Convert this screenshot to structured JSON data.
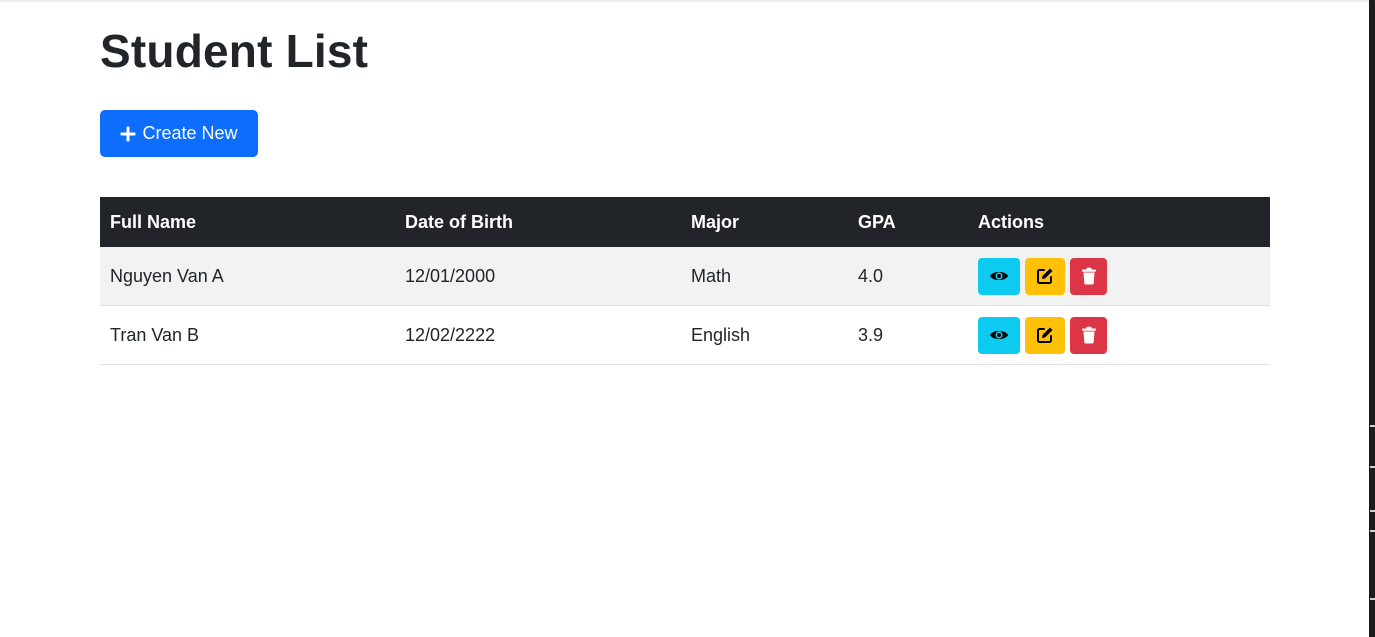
{
  "page": {
    "title": "Student List"
  },
  "toolbar": {
    "create_label": "Create New",
    "create_icon": "plus-icon",
    "create_color": "#0d6efd"
  },
  "table": {
    "header_bg": "#212529",
    "columns": [
      "Full Name",
      "Date of Birth",
      "Major",
      "GPA",
      "Actions"
    ],
    "rows": [
      {
        "full_name": "Nguyen Van A",
        "dob": "12/01/2000",
        "major": "Math",
        "gpa": "4.0"
      },
      {
        "full_name": "Tran Van B",
        "dob": "12/02/2222",
        "major": "English",
        "gpa": "3.9"
      }
    ],
    "actions": [
      {
        "name": "view",
        "icon": "eye-icon",
        "color": "#0dcaf0"
      },
      {
        "name": "edit",
        "icon": "edit-icon",
        "color": "#ffc107"
      },
      {
        "name": "delete",
        "icon": "trash-icon",
        "color": "#dc3545"
      }
    ]
  }
}
